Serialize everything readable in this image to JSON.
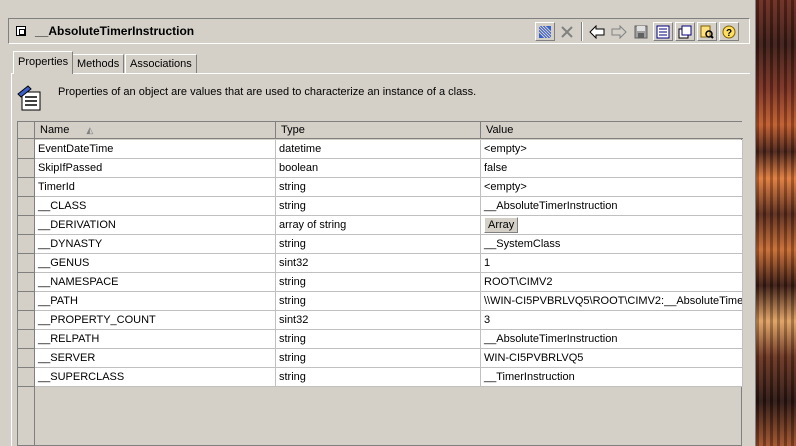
{
  "window": {
    "title": "__AbsoluteTimerInstruction"
  },
  "toolbar": {
    "buttons": [
      {
        "name": "save-object-icon",
        "glyph": "▦"
      },
      {
        "name": "delete-icon",
        "glyph": "✕"
      },
      {
        "name": "back-icon",
        "glyph": "⇦"
      },
      {
        "name": "forward-icon",
        "glyph": "⇨"
      },
      {
        "name": "save-icon",
        "glyph": "▣"
      },
      {
        "name": "mof-view-icon",
        "glyph": "☰"
      },
      {
        "name": "class-view-icon",
        "glyph": "⧉"
      },
      {
        "name": "browse-icon",
        "glyph": "⌕"
      },
      {
        "name": "help-icon",
        "glyph": "?"
      }
    ]
  },
  "tabs": [
    {
      "label": "Properties",
      "active": true
    },
    {
      "label": "Methods",
      "active": false
    },
    {
      "label": "Associations",
      "active": false
    }
  ],
  "info": {
    "text": "Properties of an object are values that are used to characterize an instance of a class."
  },
  "grid": {
    "columns": [
      "Name",
      "Type",
      "Value"
    ],
    "rows": [
      {
        "name": "EventDateTime",
        "type": "datetime",
        "value": "<empty>"
      },
      {
        "name": "SkipIfPassed",
        "type": "boolean",
        "value": "false"
      },
      {
        "name": "TimerId",
        "type": "string",
        "value": "<empty>"
      },
      {
        "name": "__CLASS",
        "type": "string",
        "value": "__AbsoluteTimerInstruction"
      },
      {
        "name": "__DERIVATION",
        "type": "array of string",
        "value": "Array",
        "is_button": true
      },
      {
        "name": "__DYNASTY",
        "type": "string",
        "value": "__SystemClass"
      },
      {
        "name": "__GENUS",
        "type": "sint32",
        "value": "1"
      },
      {
        "name": "__NAMESPACE",
        "type": "string",
        "value": "ROOT\\CIMV2"
      },
      {
        "name": "__PATH",
        "type": "string",
        "value": "\\\\WIN-CI5PVBRLVQ5\\ROOT\\CIMV2:__AbsoluteTime"
      },
      {
        "name": "__PROPERTY_COUNT",
        "type": "sint32",
        "value": "3"
      },
      {
        "name": "__RELPATH",
        "type": "string",
        "value": "__AbsoluteTimerInstruction"
      },
      {
        "name": "__SERVER",
        "type": "string",
        "value": "WIN-CI5PVBRLVQ5"
      },
      {
        "name": "__SUPERCLASS",
        "type": "string",
        "value": "__TimerInstruction"
      }
    ]
  }
}
